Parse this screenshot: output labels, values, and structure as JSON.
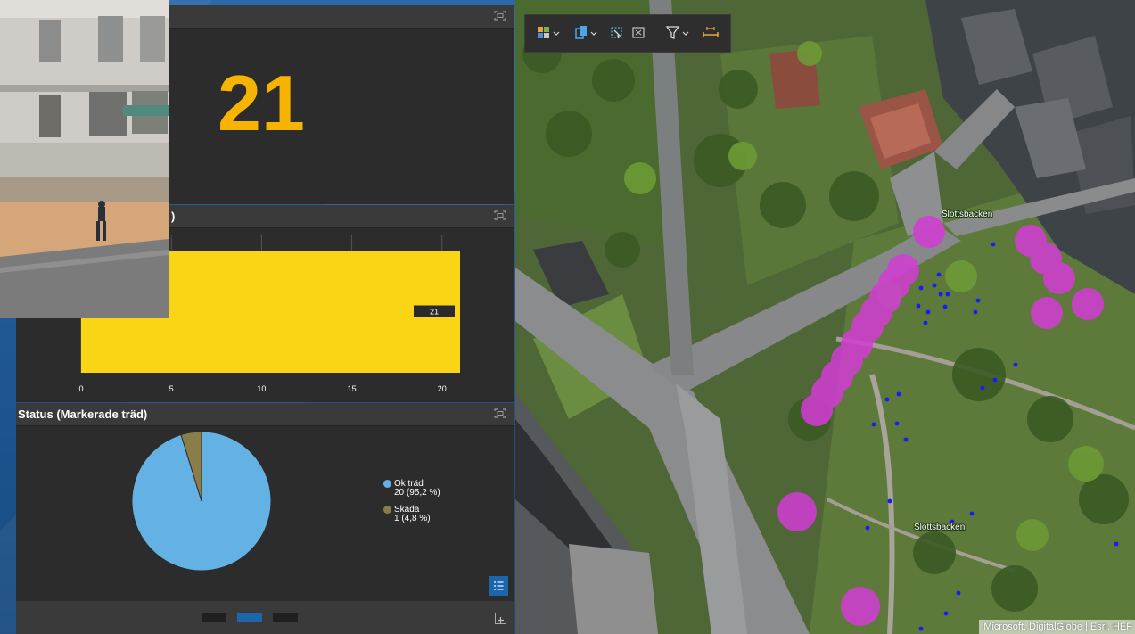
{
  "panels": {
    "count": {
      "value": "21"
    },
    "bar": {
      "title_suffix": ")"
    },
    "pie": {
      "title": "Status (Markerade träd)"
    }
  },
  "chart_data": [
    {
      "type": "bar",
      "orientation": "horizontal",
      "categories": [
        ""
      ],
      "values": [
        21
      ],
      "data_labels": [
        "21"
      ],
      "xlim": [
        0,
        21
      ],
      "x_ticks": [
        0,
        5,
        10,
        15,
        20
      ],
      "grid": true,
      "colors": [
        "#f9d515"
      ]
    },
    {
      "type": "pie",
      "title": "Status (Markerade träd)",
      "slices": [
        {
          "label": "Ok träd",
          "value": 20,
          "percent_label": "20 (95,2 %)",
          "color": "#64b2e4"
        },
        {
          "label": "Skada",
          "value": 1,
          "percent_label": "1 (4,8 %)",
          "color": "#8a7d4a"
        }
      ],
      "legend_position": "right"
    }
  ],
  "legend": {
    "ok": {
      "label": "Ok träd",
      "value": "20 (95,2 %)"
    },
    "skada": {
      "label": "Skada",
      "value": "1 (4,8 %)"
    }
  },
  "map": {
    "labels": [
      "Slottsbacken",
      "Slottsbacken"
    ],
    "attribution": "Microsoft, DigitalGlobe | Esri, HEF",
    "point_colors": {
      "buffer": "#d43bd6",
      "tree": "#1a1aff"
    }
  },
  "icons": {
    "toolbar": [
      "basemap-gallery-icon",
      "layer-list-icon",
      "select-icon",
      "zoom-extent-icon",
      "filter-icon",
      "measure-icon"
    ]
  },
  "colors": {
    "accent_number": "#f6b300",
    "bar": "#f9d515",
    "panel": "#2c2c2c",
    "header": "#3a3a3a",
    "active": "#1c66ab"
  }
}
